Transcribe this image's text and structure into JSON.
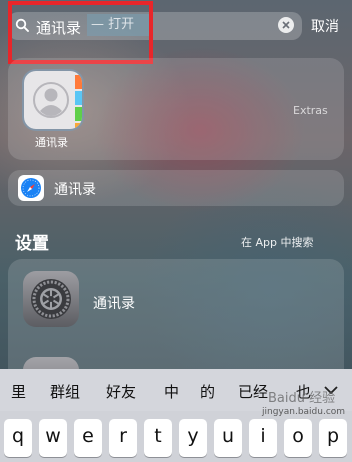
{
  "search": {
    "query": "通讯录",
    "suggestion": "— 打开",
    "cancel_label": "取消"
  },
  "top_hit": {
    "app_name": "通讯录",
    "folder": "Extras"
  },
  "safari_row": {
    "label": "通讯录"
  },
  "settings_section": {
    "title": "设置",
    "search_in_app": "在 App 中搜索",
    "result_label": "通讯录"
  },
  "keyboard": {
    "candidates": [
      "里",
      "群组",
      "好友",
      "中",
      "的",
      "已经",
      "也"
    ],
    "keys": [
      "q",
      "w",
      "e",
      "r",
      "t",
      "y",
      "u",
      "i",
      "o",
      "p"
    ]
  },
  "watermark": {
    "logo_text": "Baidu 经验",
    "url": "jingyan.baidu.com"
  },
  "colors": {
    "highlight": "#e8262a",
    "safari_blue": "#1a82f5"
  }
}
